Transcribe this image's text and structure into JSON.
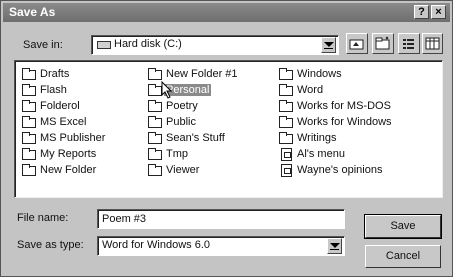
{
  "dialog": {
    "title": "Save As",
    "help_label": "?",
    "close_label": "×"
  },
  "save_in": {
    "label": "Save in:",
    "value": "Hard disk (C:)"
  },
  "files": {
    "col1": [
      "Drafts",
      "Flash",
      "Folderol",
      "MS Excel",
      "MS Publisher",
      "My Reports",
      "New Folder"
    ],
    "col2": [
      "New Folder #1",
      "Personal",
      "Poetry",
      "Public",
      "Sean's Stuff",
      "Tmp",
      "Viewer"
    ],
    "col3": [
      "Windows",
      "Word",
      "Works for MS-DOS",
      "Works for Windows",
      "Writings",
      "Al's menu",
      "Wayne's   opinions"
    ],
    "selected": "Personal"
  },
  "file_name": {
    "label": "File name:",
    "value": "Poem #3"
  },
  "save_as_type": {
    "label": "Save as type:",
    "value": "Word for Windows 6.0"
  },
  "buttons": {
    "save": "Save",
    "cancel": "Cancel"
  }
}
